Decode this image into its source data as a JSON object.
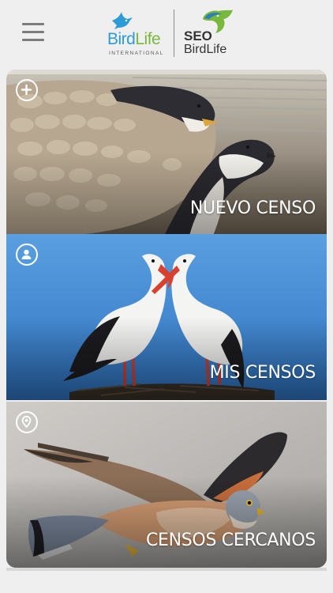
{
  "header": {
    "menu_icon": "hamburger-menu-icon",
    "logo_birdlife": {
      "name_part1": "Bird",
      "name_part2": "Life",
      "subtitle": "INTERNATIONAL"
    },
    "logo_seo": {
      "title": "SEO",
      "subtitle": "BirdLife"
    }
  },
  "cards": [
    {
      "label": "NUEVO CENSO",
      "icon": "plus-circle-icon"
    },
    {
      "label": "MIS CENSOS",
      "icon": "user-circle-icon"
    },
    {
      "label": "CENSOS CERCANOS",
      "icon": "location-pin-icon"
    }
  ],
  "colors": {
    "background": "#efefef",
    "birdlife_blue": "#2d9bd6",
    "birdlife_green": "#77b83d",
    "sky_blue": "#4f97d8",
    "label_text": "#ffffff"
  }
}
